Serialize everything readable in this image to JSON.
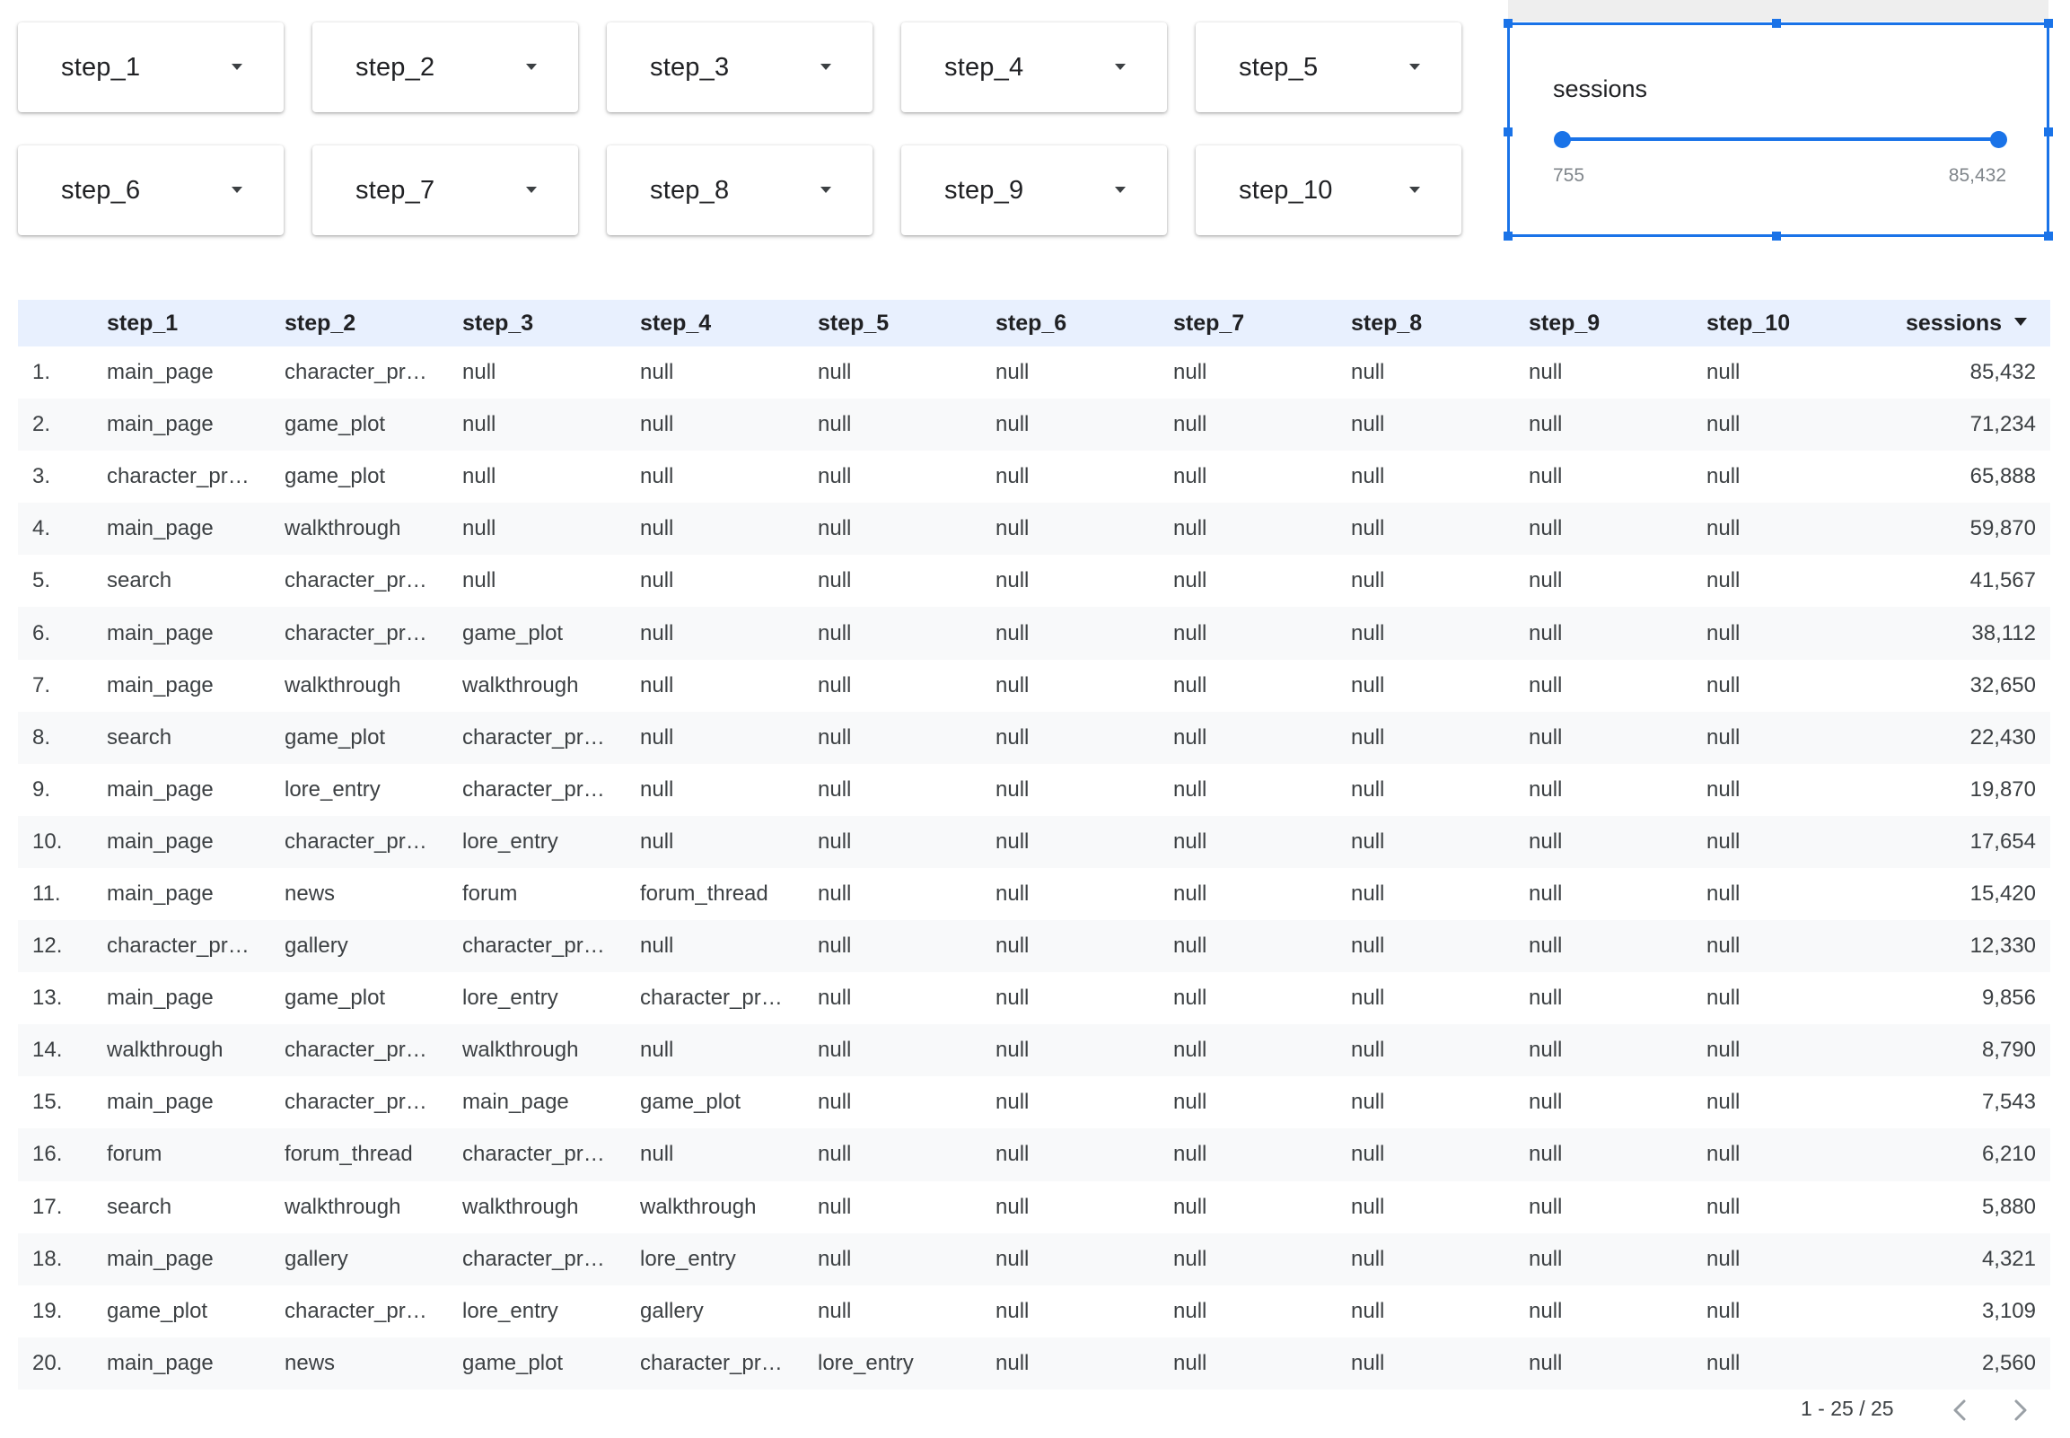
{
  "filters": [
    {
      "label": "step_1"
    },
    {
      "label": "step_2"
    },
    {
      "label": "step_3"
    },
    {
      "label": "step_4"
    },
    {
      "label": "step_5"
    },
    {
      "label": "step_6"
    },
    {
      "label": "step_7"
    },
    {
      "label": "step_8"
    },
    {
      "label": "step_9"
    },
    {
      "label": "step_10"
    }
  ],
  "slider": {
    "title": "sessions",
    "min_label": "755",
    "max_label": "85,432",
    "range": [
      755,
      85432
    ],
    "selected": [
      755,
      85432
    ],
    "accent_color": "#1a73e8"
  },
  "table": {
    "headers": [
      "step_1",
      "step_2",
      "step_3",
      "step_4",
      "step_5",
      "step_6",
      "step_7",
      "step_8",
      "step_9",
      "step_10",
      "sessions"
    ],
    "sorted_by": "sessions",
    "sort_direction": "descending",
    "header_bg": "#e8f0fe",
    "rows": [
      {
        "n": "1.",
        "cells": [
          "main_page",
          "character_pr…",
          "null",
          "null",
          "null",
          "null",
          "null",
          "null",
          "null",
          "null"
        ],
        "sessions": "85,432"
      },
      {
        "n": "2.",
        "cells": [
          "main_page",
          "game_plot",
          "null",
          "null",
          "null",
          "null",
          "null",
          "null",
          "null",
          "null"
        ],
        "sessions": "71,234"
      },
      {
        "n": "3.",
        "cells": [
          "character_pr…",
          "game_plot",
          "null",
          "null",
          "null",
          "null",
          "null",
          "null",
          "null",
          "null"
        ],
        "sessions": "65,888"
      },
      {
        "n": "4.",
        "cells": [
          "main_page",
          "walkthrough",
          "null",
          "null",
          "null",
          "null",
          "null",
          "null",
          "null",
          "null"
        ],
        "sessions": "59,870"
      },
      {
        "n": "5.",
        "cells": [
          "search",
          "character_pr…",
          "null",
          "null",
          "null",
          "null",
          "null",
          "null",
          "null",
          "null"
        ],
        "sessions": "41,567"
      },
      {
        "n": "6.",
        "cells": [
          "main_page",
          "character_pr…",
          "game_plot",
          "null",
          "null",
          "null",
          "null",
          "null",
          "null",
          "null"
        ],
        "sessions": "38,112"
      },
      {
        "n": "7.",
        "cells": [
          "main_page",
          "walkthrough",
          "walkthrough",
          "null",
          "null",
          "null",
          "null",
          "null",
          "null",
          "null"
        ],
        "sessions": "32,650"
      },
      {
        "n": "8.",
        "cells": [
          "search",
          "game_plot",
          "character_pr…",
          "null",
          "null",
          "null",
          "null",
          "null",
          "null",
          "null"
        ],
        "sessions": "22,430"
      },
      {
        "n": "9.",
        "cells": [
          "main_page",
          "lore_entry",
          "character_pr…",
          "null",
          "null",
          "null",
          "null",
          "null",
          "null",
          "null"
        ],
        "sessions": "19,870"
      },
      {
        "n": "10.",
        "cells": [
          "main_page",
          "character_pr…",
          "lore_entry",
          "null",
          "null",
          "null",
          "null",
          "null",
          "null",
          "null"
        ],
        "sessions": "17,654"
      },
      {
        "n": "11.",
        "cells": [
          "main_page",
          "news",
          "forum",
          "forum_thread",
          "null",
          "null",
          "null",
          "null",
          "null",
          "null"
        ],
        "sessions": "15,420"
      },
      {
        "n": "12.",
        "cells": [
          "character_pr…",
          "gallery",
          "character_pr…",
          "null",
          "null",
          "null",
          "null",
          "null",
          "null",
          "null"
        ],
        "sessions": "12,330"
      },
      {
        "n": "13.",
        "cells": [
          "main_page",
          "game_plot",
          "lore_entry",
          "character_pr…",
          "null",
          "null",
          "null",
          "null",
          "null",
          "null"
        ],
        "sessions": "9,856"
      },
      {
        "n": "14.",
        "cells": [
          "walkthrough",
          "character_pr…",
          "walkthrough",
          "null",
          "null",
          "null",
          "null",
          "null",
          "null",
          "null"
        ],
        "sessions": "8,790"
      },
      {
        "n": "15.",
        "cells": [
          "main_page",
          "character_pr…",
          "main_page",
          "game_plot",
          "null",
          "null",
          "null",
          "null",
          "null",
          "null"
        ],
        "sessions": "7,543"
      },
      {
        "n": "16.",
        "cells": [
          "forum",
          "forum_thread",
          "character_pr…",
          "null",
          "null",
          "null",
          "null",
          "null",
          "null",
          "null"
        ],
        "sessions": "6,210"
      },
      {
        "n": "17.",
        "cells": [
          "search",
          "walkthrough",
          "walkthrough",
          "walkthrough",
          "null",
          "null",
          "null",
          "null",
          "null",
          "null"
        ],
        "sessions": "5,880"
      },
      {
        "n": "18.",
        "cells": [
          "main_page",
          "gallery",
          "character_pr…",
          "lore_entry",
          "null",
          "null",
          "null",
          "null",
          "null",
          "null"
        ],
        "sessions": "4,321"
      },
      {
        "n": "19.",
        "cells": [
          "game_plot",
          "character_pr…",
          "lore_entry",
          "gallery",
          "null",
          "null",
          "null",
          "null",
          "null",
          "null"
        ],
        "sessions": "3,109"
      },
      {
        "n": "20.",
        "cells": [
          "main_page",
          "news",
          "game_plot",
          "character_pr…",
          "lore_entry",
          "null",
          "null",
          "null",
          "null",
          "null"
        ],
        "sessions": "2,560"
      }
    ]
  },
  "pagination": {
    "text": "1 - 25 / 25",
    "prev_icon": "chevron-left-icon",
    "next_icon": "chevron-right-icon"
  }
}
